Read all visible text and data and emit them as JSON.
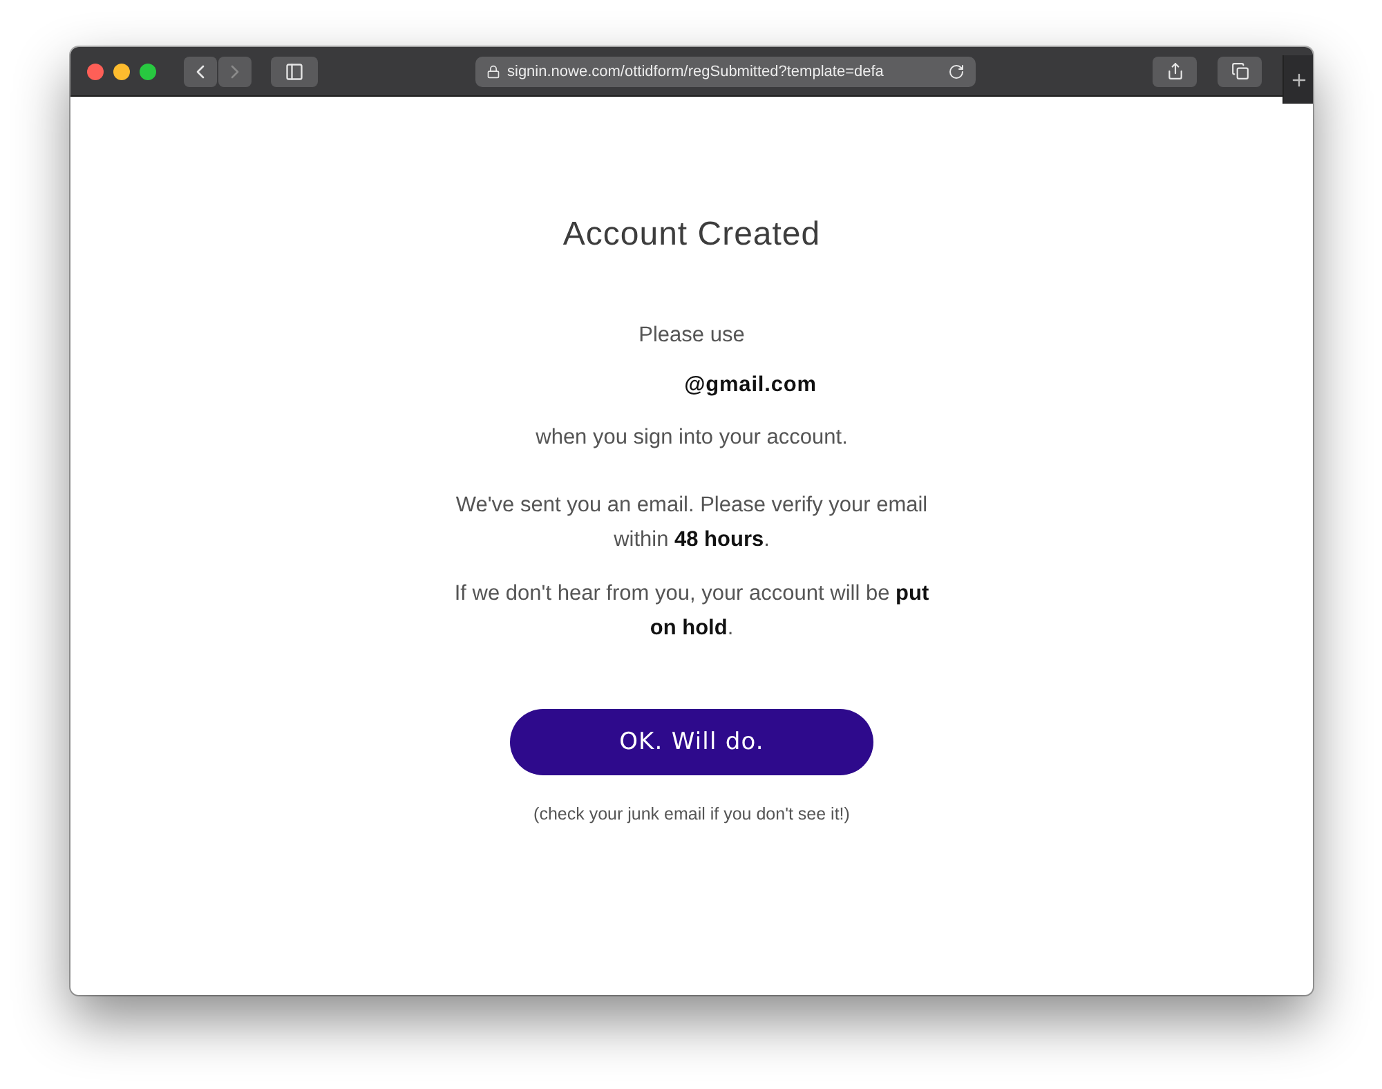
{
  "browser": {
    "url": "signin.nowe.com/ottidform/regSubmitted?template=defa",
    "back": {
      "disabled": false
    },
    "forward": {
      "disabled": true
    }
  },
  "page": {
    "title": "Account Created",
    "intro": "Please use",
    "email": "@gmail.com",
    "after_email": "when you sign into your account.",
    "paragraphs": [
      "We've sent you an email. Please verify your email within **48 hours**.",
      "If we don't hear from you, your account will be **put on hold**."
    ],
    "button": "OK. Will do.",
    "note": "(check your junk email if you don't see it!)"
  }
}
